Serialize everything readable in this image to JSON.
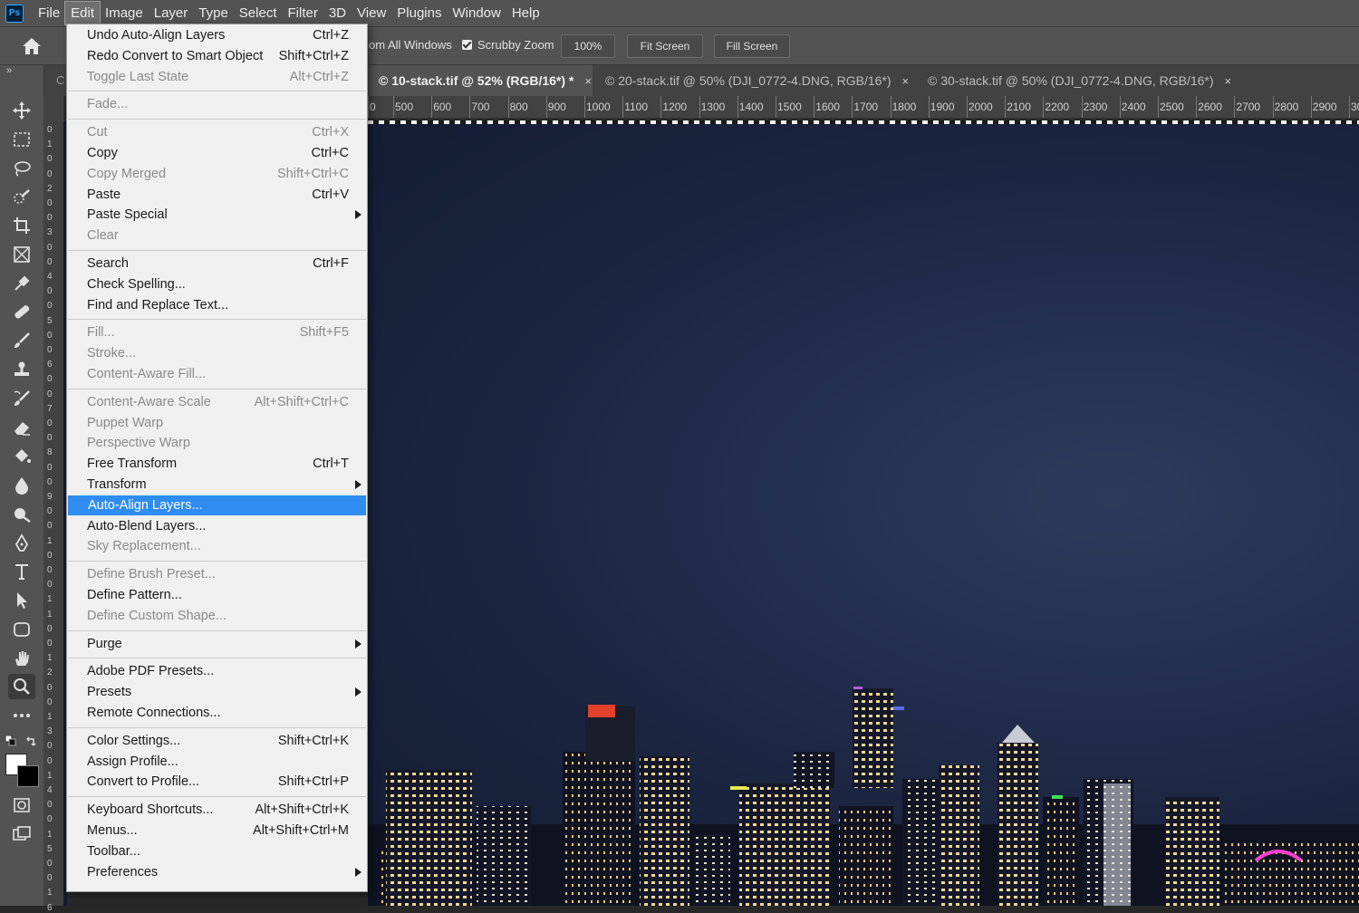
{
  "app": {
    "logo_text": "Ps"
  },
  "menubar": {
    "items": [
      "File",
      "Edit",
      "Image",
      "Layer",
      "Type",
      "Select",
      "Filter",
      "3D",
      "View",
      "Plugins",
      "Window",
      "Help"
    ],
    "active": "Edit"
  },
  "options_bar": {
    "zoom_all_windows": "om All Windows",
    "scrubby_zoom": "Scrubby Zoom",
    "scrubby_checked": true,
    "zoom_percent": "100%",
    "fit_screen": "Fit Screen",
    "fill_screen": "Fill Screen"
  },
  "tabs": {
    "items": [
      {
        "label": "© 10-stack.tif @ 52% (RGB/16*) *",
        "active": true
      },
      {
        "label": "© 20-stack.tif @ 50% (DJI_0772-4.DNG, RGB/16*)",
        "active": false
      },
      {
        "label": "© 30-stack.tif @ 50% (DJI_0772-4.DNG, RGB/16*)",
        "active": false
      }
    ],
    "close_glyph": "×",
    "chevron": "»",
    "partial_left": "C"
  },
  "rulers": {
    "horizontal": [
      "0",
      "500",
      "600",
      "700",
      "800",
      "900",
      "1000",
      "1100",
      "1200",
      "1300",
      "1400",
      "1500",
      "1600",
      "1700",
      "1800",
      "1900",
      "2000",
      "2100",
      "2200",
      "2300",
      "2400",
      "2500",
      "2600",
      "2700",
      "2800",
      "2900",
      "30"
    ],
    "vertical": [
      "0",
      "1",
      "0",
      "0",
      "2",
      "0",
      "0",
      "3",
      "0",
      "0",
      "4",
      "0",
      "0",
      "5",
      "0",
      "0",
      "6",
      "0",
      "0",
      "7",
      "0",
      "0",
      "8",
      "0",
      "0",
      "9",
      "0",
      "0",
      "1",
      "0",
      "0",
      "0",
      "1",
      "1",
      "0",
      "0",
      "1",
      "2",
      "0",
      "0",
      "1",
      "3",
      "0",
      "0",
      "1",
      "4",
      "0",
      "0",
      "1",
      "5",
      "0",
      "0",
      "1",
      "6"
    ]
  },
  "edit_menu": {
    "sections": [
      [
        {
          "label": "Undo Auto-Align Layers",
          "shortcut": "Ctrl+Z",
          "disabled": false
        },
        {
          "label": "Redo Convert to Smart Object",
          "shortcut": "Shift+Ctrl+Z",
          "disabled": false
        },
        {
          "label": "Toggle Last State",
          "shortcut": "Alt+Ctrl+Z",
          "disabled": true
        }
      ],
      [
        {
          "label": "Fade...",
          "shortcut": "",
          "disabled": true
        }
      ],
      [
        {
          "label": "Cut",
          "shortcut": "Ctrl+X",
          "disabled": true
        },
        {
          "label": "Copy",
          "shortcut": "Ctrl+C",
          "disabled": false
        },
        {
          "label": "Copy Merged",
          "shortcut": "Shift+Ctrl+C",
          "disabled": true
        },
        {
          "label": "Paste",
          "shortcut": "Ctrl+V",
          "disabled": false
        },
        {
          "label": "Paste Special",
          "shortcut": "",
          "disabled": false,
          "submenu": true
        },
        {
          "label": "Clear",
          "shortcut": "",
          "disabled": true
        }
      ],
      [
        {
          "label": "Search",
          "shortcut": "Ctrl+F",
          "disabled": false
        },
        {
          "label": "Check Spelling...",
          "shortcut": "",
          "disabled": false
        },
        {
          "label": "Find and Replace Text...",
          "shortcut": "",
          "disabled": false
        }
      ],
      [
        {
          "label": "Fill...",
          "shortcut": "Shift+F5",
          "disabled": true
        },
        {
          "label": "Stroke...",
          "shortcut": "",
          "disabled": true
        },
        {
          "label": "Content-Aware Fill...",
          "shortcut": "",
          "disabled": true
        }
      ],
      [
        {
          "label": "Content-Aware Scale",
          "shortcut": "Alt+Shift+Ctrl+C",
          "disabled": true
        },
        {
          "label": "Puppet Warp",
          "shortcut": "",
          "disabled": true
        },
        {
          "label": "Perspective Warp",
          "shortcut": "",
          "disabled": true
        },
        {
          "label": "Free Transform",
          "shortcut": "Ctrl+T",
          "disabled": false
        },
        {
          "label": "Transform",
          "shortcut": "",
          "disabled": false,
          "submenu": true
        },
        {
          "label": "Auto-Align Layers...",
          "shortcut": "",
          "disabled": false,
          "highlighted": true
        },
        {
          "label": "Auto-Blend Layers...",
          "shortcut": "",
          "disabled": false
        },
        {
          "label": "Sky Replacement...",
          "shortcut": "",
          "disabled": true
        }
      ],
      [
        {
          "label": "Define Brush Preset...",
          "shortcut": "",
          "disabled": true
        },
        {
          "label": "Define Pattern...",
          "shortcut": "",
          "disabled": false
        },
        {
          "label": "Define Custom Shape...",
          "shortcut": "",
          "disabled": true
        }
      ],
      [
        {
          "label": "Purge",
          "shortcut": "",
          "disabled": false,
          "submenu": true
        }
      ],
      [
        {
          "label": "Adobe PDF Presets...",
          "shortcut": "",
          "disabled": false
        },
        {
          "label": "Presets",
          "shortcut": "",
          "disabled": false,
          "submenu": true
        },
        {
          "label": "Remote Connections...",
          "shortcut": "",
          "disabled": false
        }
      ],
      [
        {
          "label": "Color Settings...",
          "shortcut": "Shift+Ctrl+K",
          "disabled": false
        },
        {
          "label": "Assign Profile...",
          "shortcut": "",
          "disabled": false
        },
        {
          "label": "Convert to Profile...",
          "shortcut": "Shift+Ctrl+P",
          "disabled": false
        }
      ],
      [
        {
          "label": "Keyboard Shortcuts...",
          "shortcut": "Alt+Shift+Ctrl+K",
          "disabled": false
        },
        {
          "label": "Menus...",
          "shortcut": "Alt+Shift+Ctrl+M",
          "disabled": false
        },
        {
          "label": "Toolbar...",
          "shortcut": "",
          "disabled": false
        },
        {
          "label": "Preferences",
          "shortcut": "",
          "disabled": false,
          "submenu": true
        }
      ]
    ]
  },
  "toolbar": {
    "chevron": "»",
    "tools": [
      "move-icon",
      "marquee-icon",
      "lasso-icon",
      "quick-select-icon",
      "crop-icon",
      "frame-icon",
      "eyedropper-icon",
      "healing-icon",
      "brush-icon",
      "stamp-icon",
      "history-brush-icon",
      "eraser-icon",
      "paint-bucket-icon",
      "blur-icon",
      "dodge-icon",
      "pen-icon",
      "type-icon",
      "path-select-icon",
      "shape-icon",
      "hand-icon",
      "zoom-icon",
      "more-icon"
    ],
    "active_tool": "zoom-icon",
    "foreground_color": "#ffffff",
    "background_color": "#000000"
  },
  "colors": {
    "menu_highlight": "#2f8cf0",
    "ui_panel": "#535353",
    "night_sky": "#1b2540"
  }
}
